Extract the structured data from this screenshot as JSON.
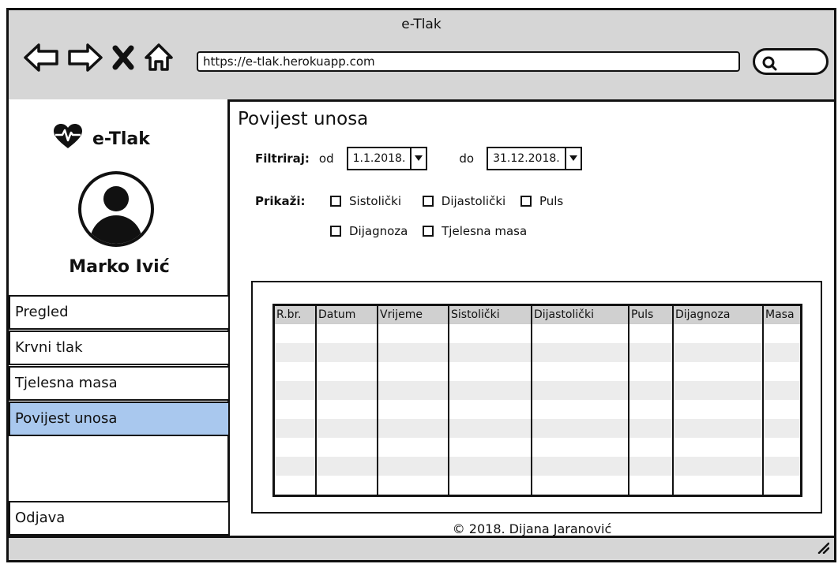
{
  "window": {
    "title": "e-Tlak"
  },
  "browser": {
    "url": "https://e-tlak.herokuapp.com"
  },
  "icons": {
    "back": "back-arrow-icon",
    "forward": "forward-arrow-icon",
    "stop": "close-x-icon",
    "home": "home-icon",
    "search": "search-icon",
    "logo": "heart-pulse-icon",
    "avatar": "user-avatar-icon",
    "dropdown": "chevron-down-icon",
    "checkbox": "checkbox-icon",
    "resize": "resize-grip-icon"
  },
  "sidebar": {
    "app_name": "e-Tlak",
    "user_name": "Marko Ivić",
    "items": [
      {
        "label": "Pregled",
        "active": false
      },
      {
        "label": "Krvni tlak",
        "active": false
      },
      {
        "label": "Tjelesna masa",
        "active": false
      },
      {
        "label": "Povijest unosa",
        "active": true
      }
    ],
    "logout_label": "Odjava",
    "active_color": "#a9c8ee"
  },
  "main": {
    "title": "Povijest unosa",
    "filter": {
      "label": "Filtriraj:",
      "from_label": "od",
      "from_value": "1.1.2018.",
      "to_label": "do",
      "to_value": "31.12.2018."
    },
    "show": {
      "label": "Prikaži:",
      "options": [
        "Sistolički",
        "Dijastolički",
        "Puls",
        "Dijagnoza",
        "Tjelesna masa"
      ]
    },
    "table": {
      "headers": [
        "R.br.",
        "Datum",
        "Vrijeme",
        "Sistolički",
        "Dijastolički",
        "Puls",
        "Dijagnoza",
        "Masa"
      ]
    },
    "footer": "© 2018. Dijana Jaranović"
  }
}
